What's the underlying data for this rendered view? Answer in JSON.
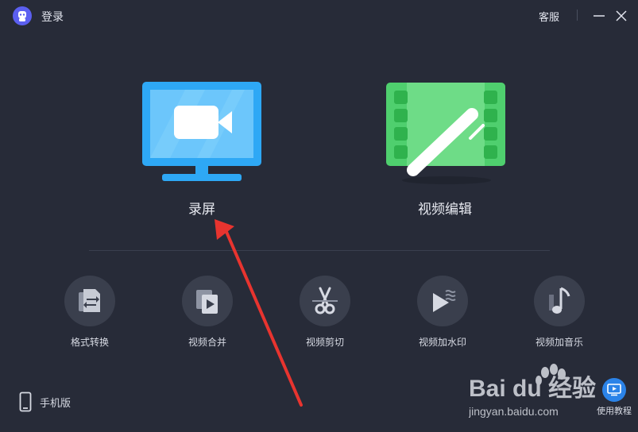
{
  "titlebar": {
    "login": "登录",
    "customer_service": "客服"
  },
  "features": [
    {
      "label": "录屏",
      "icon": "screen-record-monitor-icon"
    },
    {
      "label": "视频编辑",
      "icon": "video-edit-icon"
    }
  ],
  "tools": [
    {
      "label": "格式转换",
      "icon": "format-convert-icon"
    },
    {
      "label": "视频合并",
      "icon": "video-merge-icon"
    },
    {
      "label": "视频剪切",
      "icon": "scissors-icon"
    },
    {
      "label": "视频加水印",
      "icon": "watermark-icon"
    },
    {
      "label": "视频加音乐",
      "icon": "music-note-icon"
    }
  ],
  "footer": {
    "mobile": "手机版",
    "tutorial": "使用教程"
  },
  "watermark": {
    "text": "Bai du 经验",
    "url": "jingyan.baidu.com"
  },
  "colors": {
    "background": "#272b38",
    "record_blue": "#2ea8f5",
    "edit_green": "#4fcf6e",
    "arrow_red": "#e8342f"
  }
}
